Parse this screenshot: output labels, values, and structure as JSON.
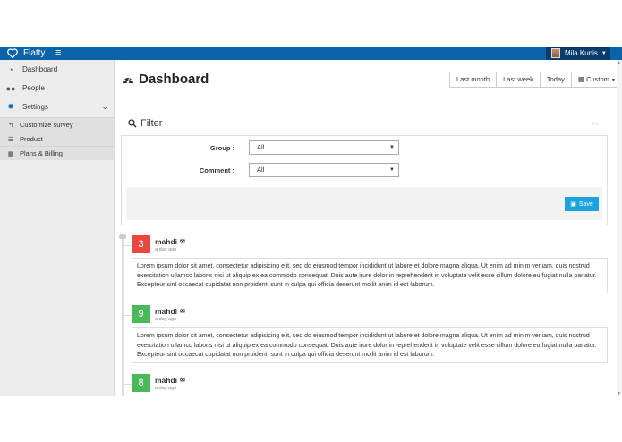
{
  "app": {
    "brand": "Flatty",
    "menu_icon": "hamburger-icon"
  },
  "user": {
    "name": "Mila Kunis"
  },
  "sidebar": {
    "items": [
      {
        "label": "Dashboard",
        "icon": "dashboard-icon"
      },
      {
        "label": "People",
        "icon": "users-icon"
      },
      {
        "label": "Settings",
        "icon": "gear-icon"
      }
    ],
    "sub_items": [
      {
        "label": "Customize survey",
        "icon": "reply-icon"
      },
      {
        "label": "Product",
        "icon": "list-icon"
      },
      {
        "label": "Plans & Billing",
        "icon": "table-icon"
      }
    ]
  },
  "header": {
    "title": "Dashboard",
    "ranges": [
      "Last month",
      "Last week",
      "Today",
      "Custom"
    ]
  },
  "filter": {
    "title": "Filter",
    "group_label": "Group :",
    "group_value": "All",
    "comment_label": "Comment :",
    "comment_value": "All",
    "save_label": "Save"
  },
  "timeline": [
    {
      "score": "3",
      "color": "#e8483f",
      "author": "mahdi",
      "time": "a day ago",
      "text": "Lorem ipsum dolor sit amet, consectetur adipisicing elit, sed do eiusmod tempor incididunt ut labore et dolore magna aliqua. Ut enim ad minim veniam, quis nostrud exercitation ullamco laboris nisi ut aliquip ex ea commodo consequat. Duis aute irure dolor in reprehenderit in voluptate velit esse cillum dolore eu fugiat nulla pariatur. Excepteur sint occaecat cupidatat non proident, sunt in culpa qui officia deserunt mollit anim id est laborum."
    },
    {
      "score": "9",
      "color": "#49b95a",
      "author": "mahdi",
      "time": "a day ago",
      "text": "Lorem ipsum dolor sit amet, consectetur adipisicing elit, sed do eiusmod tempor incididunt ut labore et dolore magna aliqua. Ut enim ad minim veniam, quis nostrud exercitation ullamco laboris nisi ut aliquip ex ea commodo consequat. Duis aute irure dolor in reprehenderit in voluptate velit esse cillum dolore eu fugiat nulla pariatur. Excepteur sint occaecat cupidatat non proident, sunt in culpa qui officia deserunt mollit anim id est laborum."
    },
    {
      "score": "8",
      "color": "#49b95a",
      "author": "mahdi",
      "time": "a day ago",
      "text": ""
    }
  ],
  "colors": {
    "topbar": "#0b63a8",
    "save": "#1aa3dc",
    "negative": "#e8483f",
    "positive": "#49b95a"
  }
}
